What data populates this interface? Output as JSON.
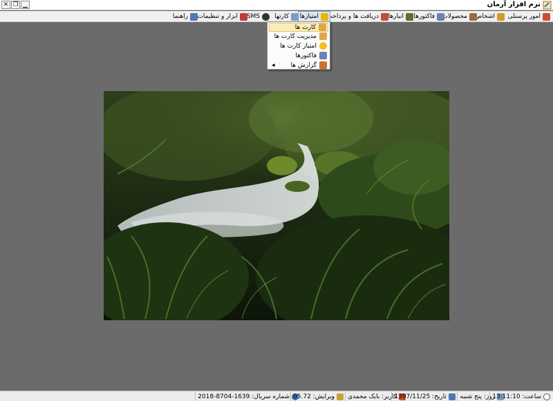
{
  "window": {
    "title": "نرم افزار آرمان",
    "buttons": [
      "✕",
      "❐",
      "▁"
    ]
  },
  "menu": {
    "items": [
      {
        "label": "امور پرسنلی",
        "icon": "staff-icon",
        "color": "#cc4d2e"
      },
      {
        "label": "اشخاص",
        "icon": "people-icon",
        "color": "#d39a2c"
      },
      {
        "label": "محصولات",
        "icon": "box-icon",
        "color": "#9a6c3a"
      },
      {
        "label": "فاکتورها",
        "icon": "invoice-icon",
        "color": "#6f7fb8"
      },
      {
        "label": "انبارها",
        "icon": "warehouse-icon",
        "color": "#cf4a4a"
      },
      {
        "label": "دریافت ها و پرداخت ها",
        "icon": "payment-icon",
        "color": "#6b8e3a"
      },
      {
        "label": "امتیازها",
        "icon": "star-icon",
        "color": "#e6b800"
      },
      {
        "label": "کارتها",
        "icon": "cards-icon",
        "color": "#7a9fc2"
      },
      {
        "label": "SMS",
        "icon": "sms-icon",
        "color": "#333333"
      },
      {
        "label": "ابزار و تنظیمات",
        "icon": "tools-icon",
        "color": "#c23a3a"
      },
      {
        "label": "راهنما",
        "icon": "help-icon",
        "color": "#4f79b3"
      }
    ]
  },
  "dropdown": {
    "items": [
      {
        "label": "کارت ها",
        "icon": "card-icon",
        "color": "#e2a54b"
      },
      {
        "label": "مدیریت کارت ها",
        "icon": "card-manage-icon",
        "color": "#e2a54b"
      },
      {
        "label": "امتیاز کارت ها",
        "icon": "star-icon",
        "color": "#f1c21b"
      },
      {
        "label": "فاکتورها",
        "icon": "invoice-icon",
        "color": "#6f7fb8"
      },
      {
        "label": "گزارش ها",
        "icon": "report-chart-icon",
        "color": "#d1702a"
      }
    ],
    "submenu_arrow": "◀"
  },
  "status": {
    "serial": "شماره سریال: 1639-8704-2018",
    "version": "ویرایش: 05.72",
    "user": "کاربر: بابک محمدی",
    "date": "تاریخ: 1397/11/25",
    "day": "روز: پنج شنبه",
    "time": "ساعت: 13:11:10"
  }
}
